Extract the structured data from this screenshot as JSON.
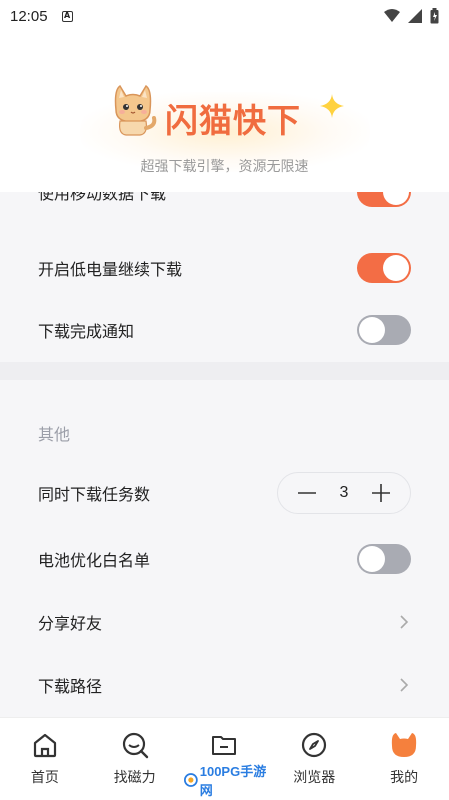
{
  "status_bar": {
    "time": "12:05"
  },
  "header": {
    "brand_name": "闪猫快下",
    "slogan": "超强下载引擎，资源无限速"
  },
  "settings": {
    "partial_row_label": "使用移动数据下载",
    "rows": [
      {
        "label": "开启低电量继续下载",
        "toggle_on": true
      },
      {
        "label": "下载完成通知",
        "toggle_on": false
      }
    ],
    "other_section": {
      "title": "其他",
      "concurrent_tasks": {
        "label": "同时下载任务数",
        "value": "3",
        "minus": "—",
        "plus": "+"
      },
      "battery_whitelist": {
        "label": "电池优化白名单",
        "toggle_on": false
      },
      "share": {
        "label": "分享好友"
      },
      "download_path": {
        "label": "下载路径"
      }
    }
  },
  "tabbar": {
    "tabs": [
      {
        "label": "首页",
        "icon": "home-icon"
      },
      {
        "label": "找磁力",
        "icon": "search-icon"
      },
      {
        "label": "",
        "icon": "folder-icon"
      },
      {
        "label": "浏览器",
        "icon": "compass-icon"
      },
      {
        "label": "我的",
        "icon": "cat-face-icon"
      }
    ]
  },
  "watermark": {
    "text": "100PG手游网"
  },
  "colors": {
    "accent": "#f36d45",
    "toggle_off": "#a9abb3",
    "brand": "#f06c3f"
  }
}
